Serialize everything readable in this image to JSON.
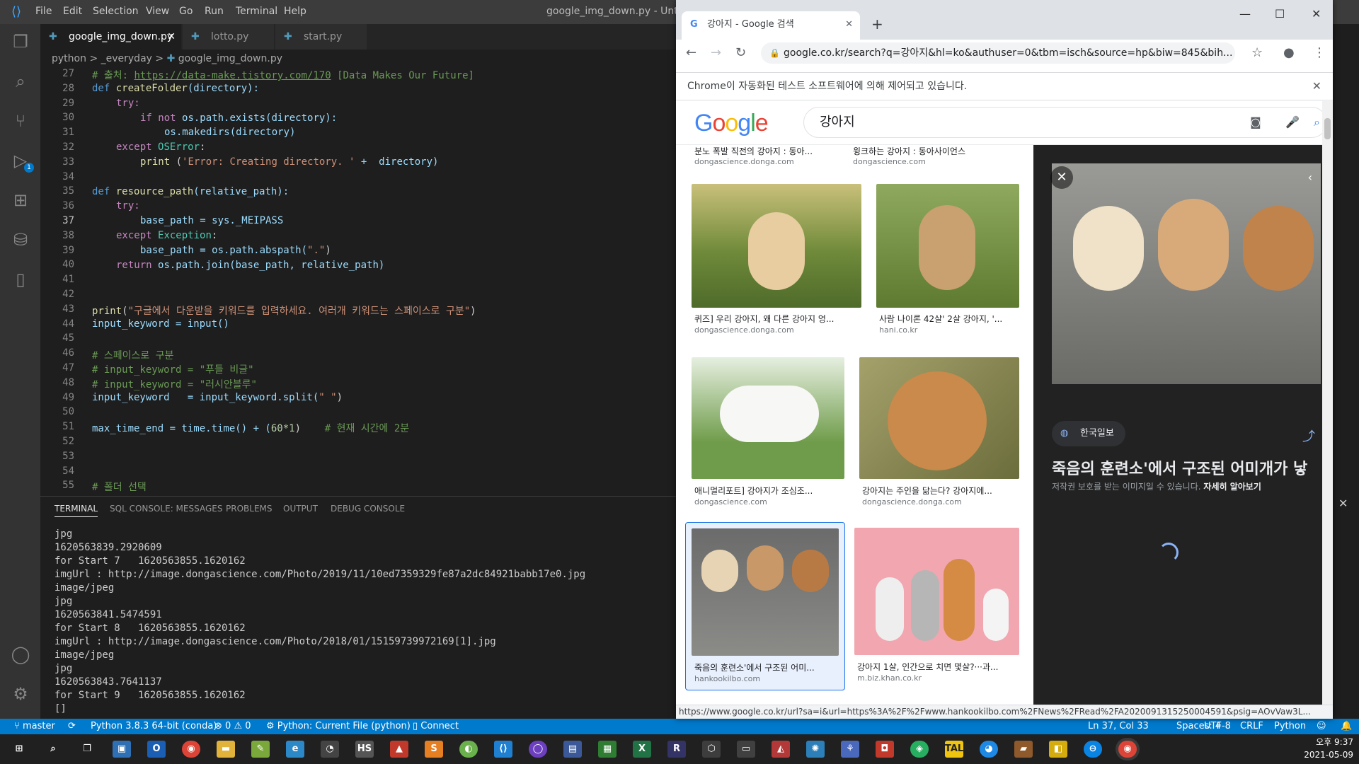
{
  "vscode": {
    "menu": [
      "File",
      "Edit",
      "Selection",
      "View",
      "Go",
      "Run",
      "Terminal",
      "Help"
    ],
    "window_title": "google_img_down.py - Untitled",
    "tabs": [
      {
        "label": "google_img_down.py"
      },
      {
        "label": "lotto.py"
      },
      {
        "label": "start.py"
      }
    ],
    "breadcrumb": {
      "folder1": "python",
      "sep": ">",
      "folder2": "_everyday",
      "file": "google_img_down.py"
    },
    "line_numbers": [
      "27",
      "28",
      "29",
      "30",
      "31",
      "32",
      "33",
      "34",
      "35",
      "36",
      "37",
      "38",
      "39",
      "40",
      "41",
      "42",
      "43",
      "44",
      "45",
      "46",
      "47",
      "48",
      "49",
      "50",
      "51",
      "52",
      "53",
      "54",
      "55"
    ],
    "code": {
      "l27_comment": "# 출처: ",
      "l27_url": "https://data-make.tistory.com/170",
      "l27_rest": " [Data Makes Our Future]",
      "l28_def": "def ",
      "l28_fn": "createFolder",
      "l28_args": "(directory):",
      "l29": "try:",
      "l30_if": "if not ",
      "l30_rest": "os.path.exists(directory):",
      "l31": "os.makedirs(directory)",
      "l32_except": "except ",
      "l32_cls": "OSError",
      "l32_colon": ":",
      "l33_print": "print ",
      "l33_open": "(",
      "l33_str": "'Error: Creating directory. '",
      "l33_rest": " +  directory)",
      "l35_def": "def ",
      "l35_fn": "resource_path",
      "l35_args": "(relative_path):",
      "l36": "try:",
      "l37": "base_path = sys._MEIPASS",
      "l38_except": "except ",
      "l38_cls": "Exception",
      "l38_colon": ":",
      "l39_a": "base_path = os.path.abspath(",
      "l39_str": "\".\"",
      "l39_b": ")",
      "l40_ret": "return ",
      "l40_rest": "os.path.join(base_path, relative_path)",
      "l43_fn": "print",
      "l43_open": "(",
      "l43_str": "\"구글에서 다운받을 키워드를 입력하세요. 여러개 키워드는 스페이스로 구분\"",
      "l43_close": ")",
      "l44": "input_keyword = input()",
      "l46": "# 스페이스로 구분",
      "l47": "# input_keyword = \"푸들 비글\"",
      "l48": "# input_keyword = \"러시안블루\"",
      "l49_a": "input_keyword   = input_keyword.split(",
      "l49_str": "\" \"",
      "l49_b": ")",
      "l51_a": "max_time_end = time.time() + (",
      "l51_num": "60*1",
      "l51_b": ")    ",
      "l51_cm": "# 현재 시간에 2분",
      "l55": "# 폴더 선택"
    },
    "panel_tabs": [
      "TERMINAL",
      "SQL CONSOLE: MESSAGES",
      "PROBLEMS",
      "OUTPUT",
      "DEBUG CONSOLE"
    ],
    "terminal_lines": [
      "jpg",
      "1620563839.2920609",
      "for Start 7   1620563855.1620162",
      "imgUrl : http://image.dongascience.com/Photo/2019/11/10ed7359329fe87a2dc84921babb17e0.jpg",
      "image/jpeg",
      "jpg",
      "1620563841.5474591",
      "for Start 8   1620563855.1620162",
      "imgUrl : http://image.dongascience.com/Photo/2018/01/15159739972169[1].jpg",
      "image/jpeg",
      "jpg",
      "1620563843.7641137",
      "for Start 9   1620563855.1620162",
      "[]"
    ],
    "status": {
      "branch": "master",
      "python": "Python 3.8.3 64-bit (conda)",
      "errors": "0",
      "warnings": "0",
      "run_config": "Python: Current File (python)",
      "connect": "Connect",
      "position": "Ln 37, Col 33",
      "spaces": "Spaces: 4",
      "encoding": "UTF-8",
      "eol": "CRLF",
      "language": "Python"
    },
    "activity_badge": "1"
  },
  "chrome": {
    "tab_title": "강아지 - Google 검색",
    "url": "google.co.kr/search?q=강아지&hl=ko&authuser=0&tbm=isch&source=hp&biw=845&bih...",
    "infobar": "Chrome이 자동화된 테스트 소프트웨어에 의해 제어되고 있습니다.",
    "search_query": "강아지",
    "top_results": [
      {
        "caption": "분노 폭발 직전의 강아지 : 동아...",
        "source": "dongascience.donga.com"
      },
      {
        "caption": "윙크하는 강아지 : 동아사이언스",
        "source": "dongascience.com"
      }
    ],
    "results": [
      {
        "caption": "퀴즈] 우리 강아지, 왜 다른 강아지 엉...",
        "source": "dongascience.donga.com"
      },
      {
        "caption": "사람 나이론 42살' 2살 강아지, '...",
        "source": "hani.co.kr"
      },
      {
        "caption": "애니멀리포트] 강아지가 조심조...",
        "source": "dongascience.com"
      },
      {
        "caption": "강아지는 주인을 닮는다? 강아지에...",
        "source": "dongascience.donga.com"
      },
      {
        "caption": "죽음의 훈련소'에서 구조된 어미...",
        "source": "hankookilbo.com"
      },
      {
        "caption": "강아지 1살, 인간으로 치면 몇살?···과...",
        "source": "m.biz.khan.co.kr"
      }
    ],
    "preview": {
      "source_badge": "한국일보",
      "title": "죽음의 훈련소'에서 구조된 어미개가 낳",
      "note": "저작권 보호를 받는 이미지일 수 있습니다.",
      "note_link": "자세히 알아보기"
    },
    "status_url": "https://www.google.co.kr/url?sa=i&url=https%3A%2F%2Fwww.hankookilbo.com%2FNews%2FRead%2FA2020091315250004591&psig=AOvVaw3L..."
  },
  "taskbar": {
    "time": "오후 9:37",
    "date": "2021-05-09"
  },
  "colors": {
    "vscode_status": "#007acc",
    "vscode_bg": "#1e1e1e",
    "google_blue": "#4285f4",
    "google_red": "#ea4335",
    "google_yellow": "#fbbc05",
    "google_green": "#34a853"
  }
}
